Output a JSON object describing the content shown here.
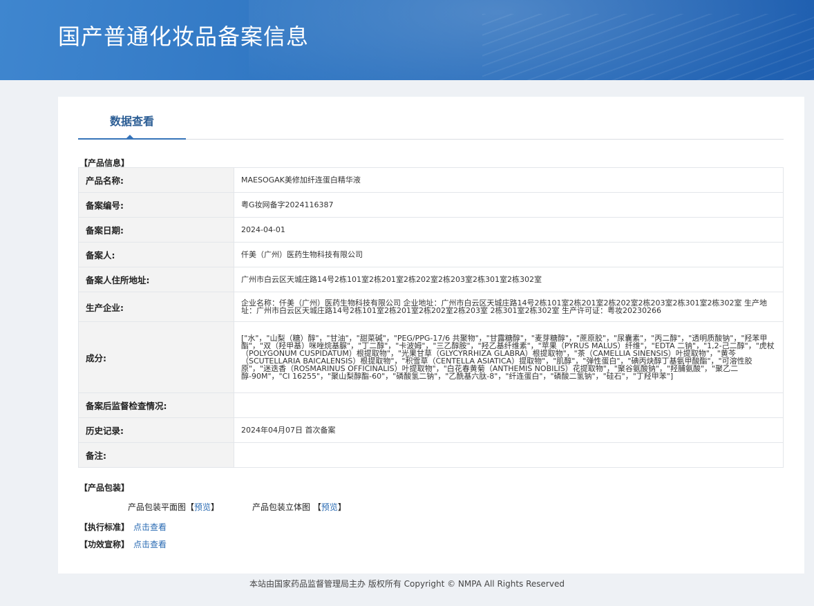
{
  "page_title": "国产普通化妆品备案信息",
  "tab_label": "数据查看",
  "product_section_label": "【产品信息】",
  "rows": [
    {
      "label": "产品名称:",
      "value": "MAESOGAK美修加纤连蛋白精华液"
    },
    {
      "label": "备案编号:",
      "value": "粤G妆网备字2024116387"
    },
    {
      "label": "备案日期:",
      "value": "2024-04-01"
    },
    {
      "label": "备案人:",
      "value": "仟美（广州）医药生物科技有限公司"
    },
    {
      "label": "备案人住所地址:",
      "value": "广州市白云区天城庄路14号2栋101室2栋201室2栋202室2栋203室2栋301室2栋302室"
    },
    {
      "label": "生产企业:",
      "value": "企业名称：仟美（广州）医药生物科技有限公司 企业地址：广州市白云区天城庄路14号2栋101室2栋201室2栋202室2栋203室2栋301室2栋302室 生产地址：广州市白云区天城庄路14号2栋101室2栋201室2栋202室2栋203室 2栋301室2栋302室 生产许可证：粤妆20230266"
    },
    {
      "label": "成分:",
      "value": "[\"水\"，\"山梨（糖）醇\"，\"甘油\"，\"甜菜碱\"，\"PEG/PPG-17/6 共聚物\"，\"甘露糖醇\"，\"麦芽糖醇\"，\"蔗原胶\"，\"尿囊素\"，\"丙二醇\"，\"透明质酸钠\"，\"羟苯甲酯\"，\"双（羟甲基）咪唑烷基脲\"，\"丁二醇\"，\"卡波姆\"，\"三乙醇胺\"，\"羟乙基纤维素\"，\"苹果（PYRUS MALUS）纤维\"，\"EDTA 二钠\"，\"1,2-己二醇\"，\"虎杖（POLYGONUM CUSPIDATUM）根提取物\"，\"光果甘草（GLYCYRRHIZA GLABRA）根提取物\"，\"茶（CAMELLIA SINENSIS）叶提取物\"，\"黄芩（SCUTELLARIA BAICALENSIS）根提取物\"，\"积雪草（CENTELLA ASIATICA）提取物\"，\"肌醇\"，\"弹性蛋白\"，\"碘丙炔醇丁基氨甲酸酯\"，\"可溶性胶原\"，\"迷迭香（ROSMARINUS OFFICINALIS）叶提取物\"，\"白花春黄菊（ANTHEMIS NOBILIS）花提取物\"，\"聚谷氨酸钠\"，\"羟脯氨酸\"，\"聚乙二醇-90M\"，\"CI 16255\"，\"聚山梨醇酯-60\"，\"磷酸氢二钠\"，\"乙酰基六肽-8\"，\"纤连蛋白\"，\"磷酸二氢钠\"，\"硅石\"，\"丁羟甲苯\"]"
    },
    {
      "label": "备案后监督检查情况:",
      "value": ""
    },
    {
      "label": "历史记录:",
      "value": "2024年04月07日 首次备案"
    },
    {
      "label": "备注:",
      "value": ""
    }
  ],
  "packaging": {
    "section_label": "【产品包装】",
    "flat_label": "产品包装平面图",
    "stereo_label": "产品包装立体图",
    "bracket_open": "【",
    "bracket_close": "】",
    "preview_label": "预览"
  },
  "standard": {
    "label": "【执行标准】",
    "link": "点击查看"
  },
  "efficacy": {
    "label": "【功效宣称】",
    "link": "点击查看"
  },
  "footer": "本站由国家药品监督管理局主办 版权所有 Copyright © NMPA All Rights Reserved"
}
